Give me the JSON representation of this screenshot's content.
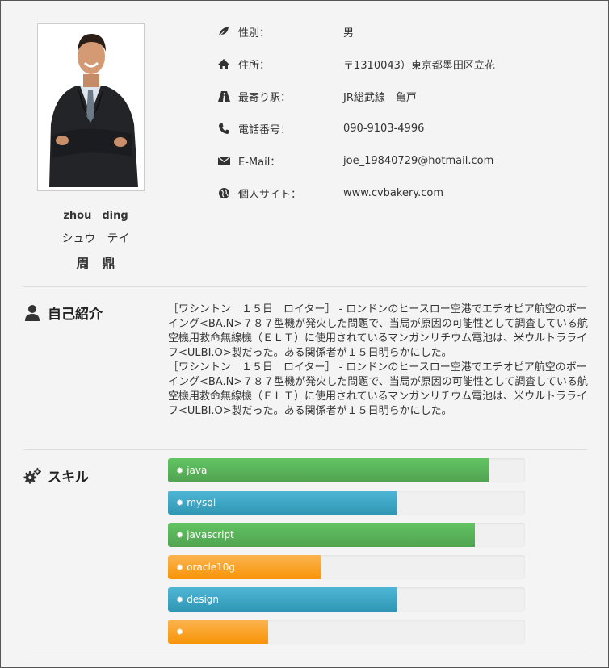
{
  "profile": {
    "name_latin": "zhou　ding",
    "name_kana": "シュウ　テイ",
    "name_kanji": "周　鼎"
  },
  "info": [
    {
      "icon": "leaf-icon",
      "label": "性別：",
      "value": "男"
    },
    {
      "icon": "home-icon",
      "label": "住所：",
      "value": "〒1310043）東京都墨田区立花"
    },
    {
      "icon": "road-icon",
      "label": "最寄り駅：",
      "value": "JR総武線　亀戸"
    },
    {
      "icon": "phone-icon",
      "label": "電話番号：",
      "value": "090-9103-4996"
    },
    {
      "icon": "envelope-icon",
      "label": "E-Mail：",
      "value": "joe_19840729@hotmail.com"
    },
    {
      "icon": "globe-icon",
      "label": "個人サイト：",
      "value": "www.cvbakery.com"
    }
  ],
  "intro": {
    "title": "自己紹介",
    "paragraphs": [
      "［ワシントン　１５日　ロイター］ - ロンドンのヒースロー空港でエチオピア航空のボーイング<BA.N>７８７型機が発火した問題で、当局が原因の可能性として調査している航空機用救命無線機（ＥＬＴ）に使用されているマンガンリチウム電池は、米ウルトラライフ<ULBI.O>製だった。ある関係者が１５日明らかにした。",
      "［ワシントン　１５日　ロイター］ - ロンドンのヒースロー空港でエチオピア航空のボーイング<BA.N>７８７型機が発火した問題で、当局が原因の可能性として調査している航空機用救命無線機（ＥＬＴ）に使用されているマンガンリチウム電池は、米ウルトラライフ<ULBI.O>製だった。ある関係者が１５日明らかにした。"
    ]
  },
  "skills": {
    "title": "スキル",
    "items": [
      {
        "name": "java",
        "level": 0.9,
        "color": "green"
      },
      {
        "name": "mysql",
        "level": 0.64,
        "color": "blue"
      },
      {
        "name": "javascript",
        "level": 0.86,
        "color": "green"
      },
      {
        "name": "oracle10g",
        "level": 0.43,
        "color": "orange"
      },
      {
        "name": "design",
        "level": 0.64,
        "color": "blue"
      },
      {
        "name": "",
        "level": 0.28,
        "color": "orange"
      }
    ]
  }
}
